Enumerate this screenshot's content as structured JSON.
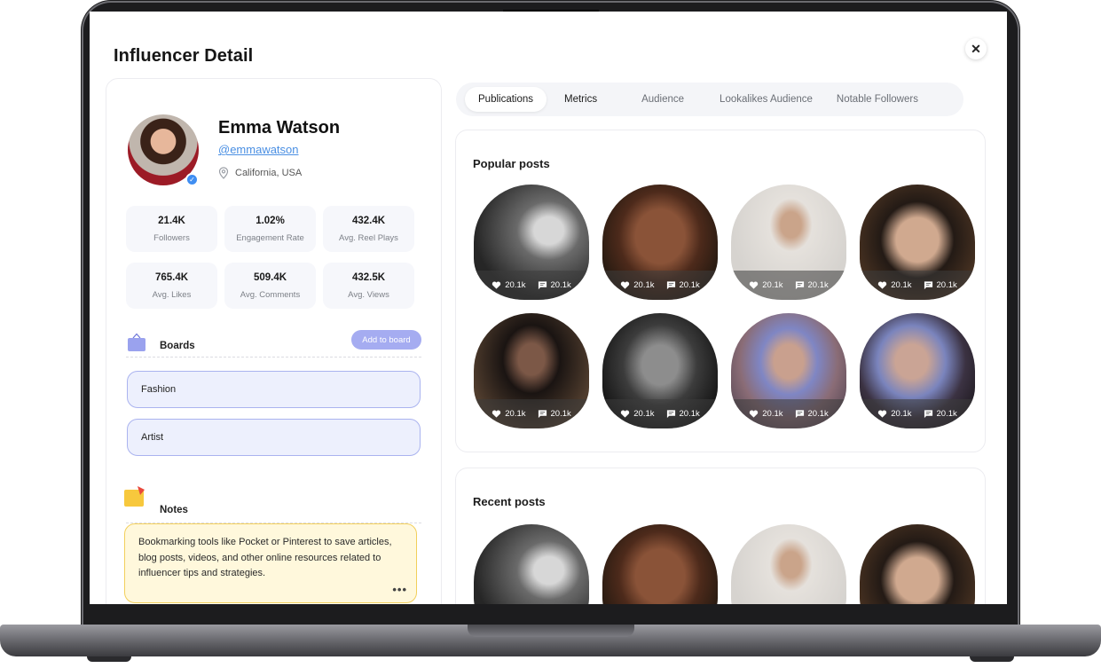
{
  "window": {
    "title": "Influencer Detail",
    "close_icon": "close-icon"
  },
  "profile": {
    "name": "Emma Watson",
    "handle": "@emmawatson",
    "location": "California, USA",
    "verified_icon": "verified-check-icon"
  },
  "stats": [
    {
      "value": "21.4K",
      "label": "Followers"
    },
    {
      "value": "1.02%",
      "label": "Engagement Rate"
    },
    {
      "value": "432.4K",
      "label": "Avg. Reel Plays"
    },
    {
      "value": "765.4K",
      "label": "Avg. Likes"
    },
    {
      "value": "509.4K",
      "label": "Avg. Comments"
    },
    {
      "value": "432.5K",
      "label": "Avg. Views"
    }
  ],
  "boards": {
    "title": "Boards",
    "add_label": "Add to board",
    "items": [
      "Fashion",
      "Artist"
    ]
  },
  "notes": {
    "title": "Notes",
    "text": "Bookmarking tools like Pocket or Pinterest to save articles, blog posts, videos, and other online resources related to influencer tips and strategies.",
    "more": "•••"
  },
  "tabs": [
    {
      "label": "Publications",
      "active": true
    },
    {
      "label": "Metrics",
      "active": false
    },
    {
      "label": "Audience",
      "active": false
    },
    {
      "label": "Lookalikes Audience",
      "active": false
    },
    {
      "label": "Notable Followers",
      "active": false
    }
  ],
  "popular_posts": {
    "title": "Popular posts",
    "items": [
      {
        "likes": "20.1k",
        "comments": "20.1k"
      },
      {
        "likes": "20.1k",
        "comments": "20.1k"
      },
      {
        "likes": "20.1k",
        "comments": "20.1k"
      },
      {
        "likes": "20.1k",
        "comments": "20.1k"
      },
      {
        "likes": "20.1k",
        "comments": "20.1k"
      },
      {
        "likes": "20.1k",
        "comments": "20.1k"
      },
      {
        "likes": "20.1k",
        "comments": "20.1k"
      },
      {
        "likes": "20.1k",
        "comments": "20.1k"
      }
    ]
  },
  "recent_posts": {
    "title": "Recent posts"
  },
  "colors": {
    "accent": "#a5acf1",
    "link": "#4a8fe3",
    "board_border": "#aab3ef",
    "note_border": "#f2cf5b"
  }
}
